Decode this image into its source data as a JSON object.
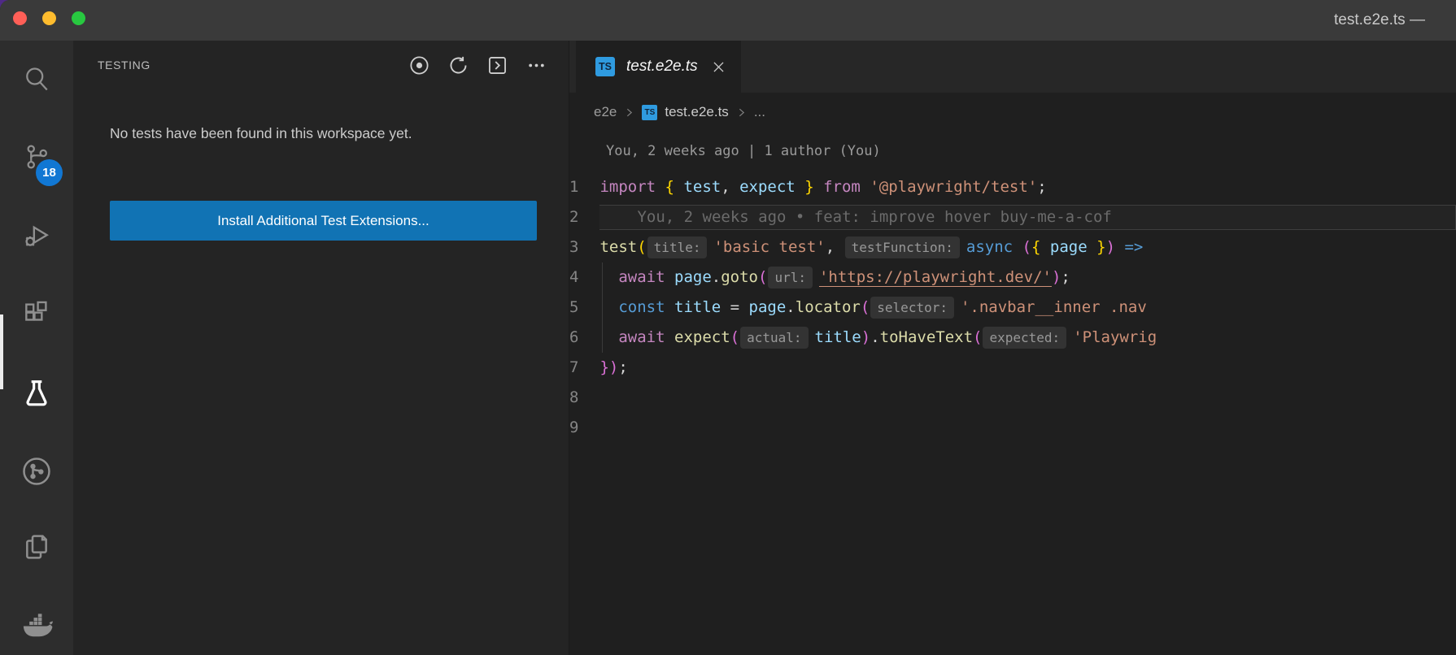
{
  "window": {
    "title": "test.e2e.ts —"
  },
  "colors": {
    "accent-button": "#1173b4",
    "accent-badge": "#1177d3",
    "accent-ts": "#2f9be0",
    "tok-kw": "#c586c0",
    "tok-kw2": "#569cd6",
    "tok-var": "#9cdcfe",
    "tok-fn": "#dcdcaa",
    "tok-str": "#ce9178",
    "tok-pl": "#d4d4d4",
    "tok-b1": "#ffd700",
    "tok-b2": "#da70d6"
  },
  "activity_bar": {
    "items": [
      {
        "icon": "search-icon"
      },
      {
        "icon": "source-control-icon",
        "badge": "18"
      },
      {
        "icon": "run-debug-icon"
      },
      {
        "icon": "extensions-icon"
      },
      {
        "icon": "testing-flask-icon",
        "active": true
      },
      {
        "icon": "gitlens-icon"
      },
      {
        "icon": "copy-pages-icon"
      },
      {
        "icon": "docker-whale-icon"
      }
    ]
  },
  "sidebar": {
    "title": "TESTING",
    "actions": [
      "target-icon",
      "refresh-icon",
      "chevron-right-box-icon",
      "more-actions-icon"
    ],
    "message": "No tests have been found in this workspace yet.",
    "button_label": "Install Additional Test Extensions..."
  },
  "editor": {
    "tab": {
      "icon_text": "TS",
      "label": "test.e2e.ts"
    },
    "breadcrumb": {
      "folder": "e2e",
      "file": "test.e2e.ts",
      "more": "..."
    },
    "codelens": "You, 2 weeks ago | 1 author (You)",
    "code": {
      "lines": [
        {
          "n": "1",
          "tokens": [
            [
              "import ",
              "kw"
            ],
            [
              "{",
              "b1"
            ],
            [
              " ",
              "pl"
            ],
            [
              "test",
              "var"
            ],
            [
              ", ",
              "pl"
            ],
            [
              "expect",
              "var"
            ],
            [
              " ",
              "pl"
            ],
            [
              "}",
              "b1"
            ],
            [
              " ",
              "pl"
            ],
            [
              "from",
              "kw"
            ],
            [
              " ",
              "pl"
            ],
            [
              "'@playwright/test'",
              "str"
            ],
            [
              ";",
              "pl"
            ]
          ]
        },
        {
          "n": "2",
          "blame": "You, 2 weeks ago • feat: improve hover buy-me-a-cof"
        },
        {
          "n": "3",
          "tokens": [
            [
              "test",
              "fn"
            ],
            [
              "(",
              "b1"
            ],
            [
              "title:",
              "chip"
            ],
            [
              "'basic test'",
              "str"
            ],
            [
              ", ",
              "pl"
            ],
            [
              "testFunction:",
              "chip"
            ],
            [
              "async",
              "kw2"
            ],
            [
              " ",
              "pl"
            ],
            [
              "(",
              "b2"
            ],
            [
              "{",
              "b1"
            ],
            [
              " ",
              "pl"
            ],
            [
              "page",
              "var"
            ],
            [
              " ",
              "pl"
            ],
            [
              "}",
              "b1"
            ],
            [
              ")",
              "b2"
            ],
            [
              " ",
              "pl"
            ],
            [
              "=>",
              "kw2"
            ]
          ]
        },
        {
          "n": "4",
          "guide": true,
          "tokens": [
            [
              "  ",
              "pl"
            ],
            [
              "await",
              "kw"
            ],
            [
              " ",
              "pl"
            ],
            [
              "page",
              "var"
            ],
            [
              ".",
              "pl"
            ],
            [
              "goto",
              "fn"
            ],
            [
              "(",
              "b2"
            ],
            [
              "url:",
              "chip"
            ],
            [
              "'https://playwright.dev/'",
              "strlink"
            ],
            [
              ")",
              "b2"
            ],
            [
              ";",
              "pl"
            ]
          ]
        },
        {
          "n": "5",
          "guide": true,
          "tokens": [
            [
              "  ",
              "pl"
            ],
            [
              "const",
              "kw2"
            ],
            [
              " ",
              "pl"
            ],
            [
              "title",
              "var"
            ],
            [
              " = ",
              "pl"
            ],
            [
              "page",
              "var"
            ],
            [
              ".",
              "pl"
            ],
            [
              "locator",
              "fn"
            ],
            [
              "(",
              "b2"
            ],
            [
              "selector:",
              "chip"
            ],
            [
              "'.navbar__inner .nav",
              "str"
            ]
          ]
        },
        {
          "n": "6",
          "guide": true,
          "tokens": [
            [
              "  ",
              "pl"
            ],
            [
              "await",
              "kw"
            ],
            [
              " ",
              "pl"
            ],
            [
              "expect",
              "fn"
            ],
            [
              "(",
              "b2"
            ],
            [
              "actual:",
              "chip"
            ],
            [
              "title",
              "var"
            ],
            [
              ")",
              "b2"
            ],
            [
              ".",
              "pl"
            ],
            [
              "toHaveText",
              "fn"
            ],
            [
              "(",
              "b2"
            ],
            [
              "expected:",
              "chip"
            ],
            [
              "'Playwrig",
              "str"
            ]
          ]
        },
        {
          "n": "7",
          "tokens": [
            [
              "}",
              "b2"
            ],
            [
              ")",
              "b2"
            ],
            [
              ";",
              "pl"
            ]
          ]
        },
        {
          "n": "8",
          "tokens": []
        },
        {
          "n": "9",
          "tokens": []
        }
      ]
    }
  }
}
